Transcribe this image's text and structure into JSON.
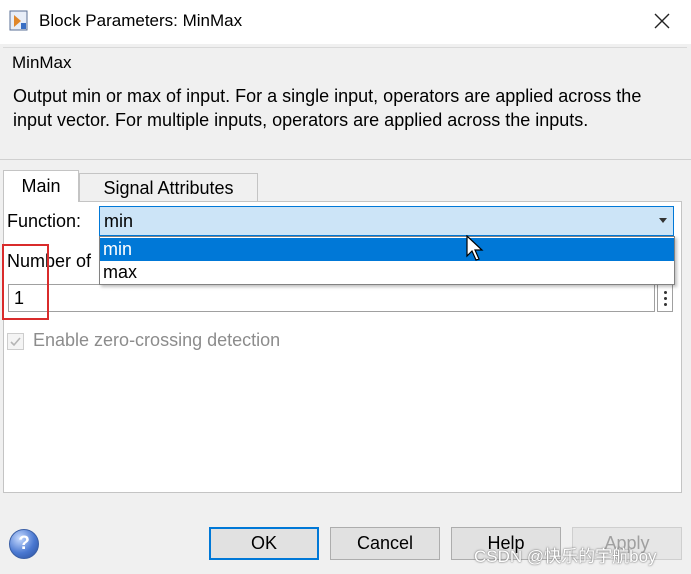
{
  "window": {
    "title": "Block Parameters: MinMax",
    "icons": {
      "app": "simulink-block-icon",
      "close": "close-icon"
    }
  },
  "block": {
    "name": "MinMax",
    "description": "Output min or max of input.  For a single input, operators are applied across the input vector.  For multiple inputs, operators are applied across the inputs."
  },
  "tabs": [
    {
      "label": "Main",
      "active": true
    },
    {
      "label": "Signal Attributes",
      "active": false
    }
  ],
  "main": {
    "function_label": "Function:",
    "function_value": "min",
    "function_options": [
      "min",
      "max"
    ],
    "highlighted_option": "min",
    "number_label": "Number of",
    "number_value": "1",
    "checkbox_label": "Enable zero-crossing detection",
    "checkbox_checked": true,
    "checkbox_enabled": false
  },
  "buttons": {
    "ok": "OK",
    "cancel": "Cancel",
    "help": "Help",
    "apply": "Apply",
    "help_icon": "?"
  },
  "watermark": "CSDN @快乐的宇航boy",
  "colors": {
    "accent": "#0078d7",
    "select_bg": "#cce4f7",
    "highlight_box": "#d92b2b",
    "dialog_bg": "#f0f0f0"
  }
}
